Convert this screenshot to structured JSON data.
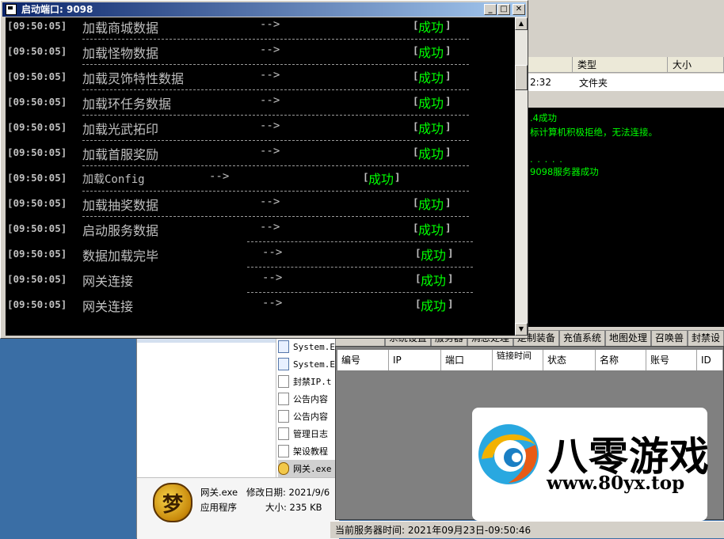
{
  "console": {
    "title": "启动端口: 9098",
    "lines": [
      {
        "time": "[09:50:05]",
        "msg": "加载商城数据",
        "arrow": "-->",
        "open": "[",
        "status": "成功",
        "close": "]"
      },
      {
        "time": "[09:50:05]",
        "msg": "加载怪物数据",
        "arrow": "-->",
        "open": "[",
        "status": "成功",
        "close": "]"
      },
      {
        "time": "[09:50:05]",
        "msg": "加载灵饰特性数据",
        "arrow": "-->",
        "open": "[",
        "status": "成功",
        "close": "]"
      },
      {
        "time": "[09:50:05]",
        "msg": "加载环任务数据",
        "arrow": "-->",
        "open": "[",
        "status": "成功",
        "close": "]"
      },
      {
        "time": "[09:50:05]",
        "msg": "加载光武拓印",
        "arrow": "-->",
        "open": "[",
        "status": "成功",
        "close": "]"
      },
      {
        "time": "[09:50:05]",
        "msg": "加载首服奖励",
        "arrow": "-->",
        "open": "[",
        "status": "成功",
        "close": "]"
      },
      {
        "time": "[09:50:05]",
        "msg": "加载Config",
        "arrow": "-->",
        "open": "[",
        "status": "成功",
        "close": "]"
      },
      {
        "time": "[09:50:05]",
        "msg": "加载抽奖数据",
        "arrow": "-->",
        "open": "[",
        "status": "成功",
        "close": "]"
      },
      {
        "time": "[09:50:05]",
        "msg": "启动服务数据",
        "arrow": "-->",
        "open": "[",
        "status": "成功",
        "close": "]"
      },
      {
        "time": "[09:50:05]",
        "msg": "数据加载完毕",
        "arrow": "-->",
        "open": "[",
        "status": "成功",
        "close": "]"
      },
      {
        "time": "[09:50:05]",
        "msg": "网关连接",
        "arrow": "-->",
        "open": "[",
        "status": "成功",
        "close": "]"
      },
      {
        "time": "[09:50:05]",
        "msg": "网关连接",
        "arrow": "-->",
        "open": "[",
        "status": "成功",
        "close": "]"
      }
    ]
  },
  "gm_tool": {
    "columns": [
      "类型",
      "大小"
    ],
    "row": {
      "time": "2:32",
      "type": "文件夹"
    },
    "log_lines": [
      ".4成功",
      "标计算机积极拒绝，无法连接。",
      ". . . . .",
      "9098服务器成功"
    ],
    "tabs": [
      "系统设置",
      "服务器",
      "消息处理",
      "定制装备",
      "充值系统",
      "地图处理",
      "召唤兽",
      "封禁设"
    ],
    "grid_columns": [
      "编号",
      "IP",
      "端口",
      "链接时间",
      "状态",
      "名称",
      "账号",
      "ID"
    ],
    "status": "当前服务器时间: 2021年09月23日-09:50:46"
  },
  "explorer": {
    "files": [
      {
        "name": "System.E",
        "icon": "config-file-icon"
      },
      {
        "name": "System.E",
        "icon": "config-file-icon"
      },
      {
        "name": "封禁IP.t",
        "icon": "text-file-icon"
      },
      {
        "name": "公告内容",
        "icon": "text-file-icon"
      },
      {
        "name": "公告内容",
        "icon": "text-file-icon"
      },
      {
        "name": "管理日志",
        "icon": "text-file-icon"
      },
      {
        "name": "架设教程",
        "icon": "text-file-icon"
      },
      {
        "name": "网关.exe",
        "icon": "exe-file-icon"
      }
    ],
    "details": {
      "name": "网关.exe",
      "modified": "修改日期: 2021/9/6",
      "type": "应用程序",
      "size": "大小: 235 KB",
      "icon_glyph": "梦"
    }
  },
  "watermark": {
    "title": "八零游戏",
    "url": "www.80yx.top"
  }
}
